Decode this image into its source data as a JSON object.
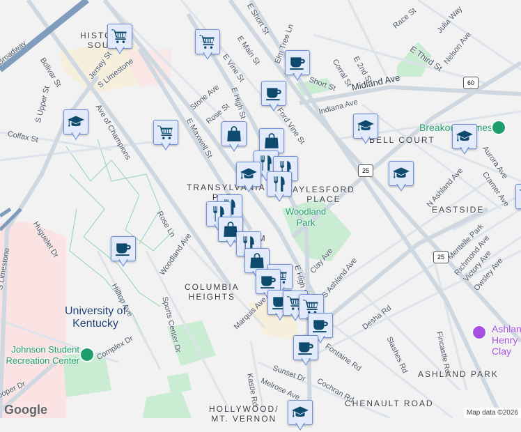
{
  "map": {
    "streets": [
      "Broadway",
      "Bolivar St",
      "Jersey St",
      "S Limestone",
      "Ave of Champions",
      "S Upper St",
      "Colfax St",
      "S Limestone",
      "E Maxwell St",
      "Stone Ave",
      "Rose St",
      "E Vine St",
      "E High St",
      "E Main St",
      "E Short St",
      "Elm Tree Ln",
      "Short St",
      "Midland Ave",
      "Indiana Ave",
      "Corral St",
      "E 2nd St",
      "Race St",
      "Julia Way",
      "E Third St",
      "Nelson Ave",
      "Aurora Ave",
      "Cramer Ave",
      "N Ashland Ave",
      "Mentelle Park",
      "Richmond Ave",
      "Victory Ave",
      "Owsley Ave",
      "Clay Ave",
      "S Ashland Ave",
      "E High St",
      "Desha Rd",
      "Slashes Rd",
      "Fincastle Rd",
      "Fontaine Rd",
      "Sunset Dr",
      "Cochran Rd",
      "Melrose Ave",
      "Kastle Rd",
      "Marquis Ave",
      "Woodland Ave",
      "Sports Center Dr",
      "Rose Ln",
      "Hilltop Ave",
      "Huguelet Dr",
      "Complex Dr",
      "Cooper Dr",
      "Ford Vine St",
      "E High St"
    ],
    "neighborhoods": [
      "HISTORIC\nSOUTH",
      "TRANSYLVANIA\nPARK",
      "AYLESFORD\nPLACE",
      "BELL COURT",
      "EASTSIDE",
      "ASHLAND PARK",
      "CHENAULT ROAD",
      "COLUMBIA\nHEIGHTS",
      "HOLLYWOOD/\nMT. VERNON",
      "HAM\nUE"
    ],
    "places": {
      "university": "University of Kentucky",
      "rec_center": "Johnson Student Recreation Center",
      "breakout": "Breakout Games",
      "ashland": "Ashland Henry Clay",
      "woodland": "Woodland Park"
    },
    "route_shields": [
      "60",
      "25",
      "25"
    ],
    "marker_types": [
      "grocery-cart",
      "coffee",
      "school",
      "shopping-bag",
      "restaurant"
    ],
    "google_logo": "Google",
    "attribution": "Map data ©2026",
    "colors": {
      "marker_fill": "#e3ebfb",
      "marker_border": "#6f8fd8",
      "marker_icon": "#0d4a6e",
      "park": "#c8ecd2",
      "campus": "#fbe2e2",
      "poi_green": "#1e9e6a",
      "poi_purple": "#a451e0"
    }
  }
}
